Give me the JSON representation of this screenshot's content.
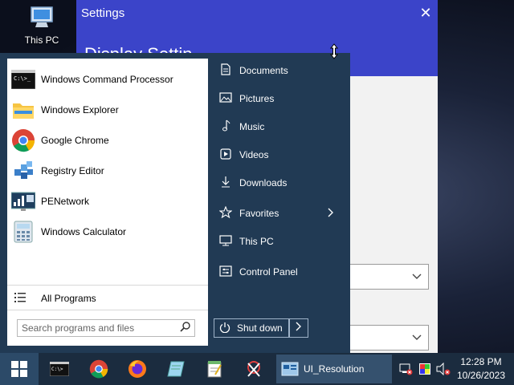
{
  "desktop": {
    "icon_label": "This PC"
  },
  "settings": {
    "title": "Settings",
    "header_partial": "Display Settin",
    "close_glyph": "✕",
    "dropdown_chevron": "⌵"
  },
  "start_menu": {
    "programs": [
      {
        "label": "Windows Command Processor",
        "icon": "cmd-icon"
      },
      {
        "label": "Windows Explorer",
        "icon": "folder-icon"
      },
      {
        "label": "Google Chrome",
        "icon": "chrome-icon"
      },
      {
        "label": "Registry Editor",
        "icon": "registry-icon"
      },
      {
        "label": "PENetwork",
        "icon": "network-icon"
      },
      {
        "label": "Windows Calculator",
        "icon": "calculator-icon"
      }
    ],
    "all_programs": "All Programs",
    "search_placeholder": "Search programs and files",
    "places": [
      {
        "label": "Documents",
        "icon": "document-icon"
      },
      {
        "label": "Pictures",
        "icon": "picture-icon"
      },
      {
        "label": "Music",
        "icon": "music-icon"
      },
      {
        "label": "Videos",
        "icon": "video-icon"
      },
      {
        "label": "Downloads",
        "icon": "download-icon"
      },
      {
        "label": "Favorites",
        "icon": "star-icon",
        "has_submenu": true
      },
      {
        "label": "This PC",
        "icon": "monitor-icon"
      },
      {
        "label": "Control Panel",
        "icon": "control-panel-icon"
      }
    ],
    "shutdown_label": "Shut down"
  },
  "taskbar": {
    "window_label": "UI_Resolution",
    "time": "12:28 PM",
    "date": "10/26/2023"
  },
  "colors": {
    "accent": "#3b44c9",
    "start_menu_bg": "#213a54",
    "taskbar_bg": "#1b2c3f"
  }
}
